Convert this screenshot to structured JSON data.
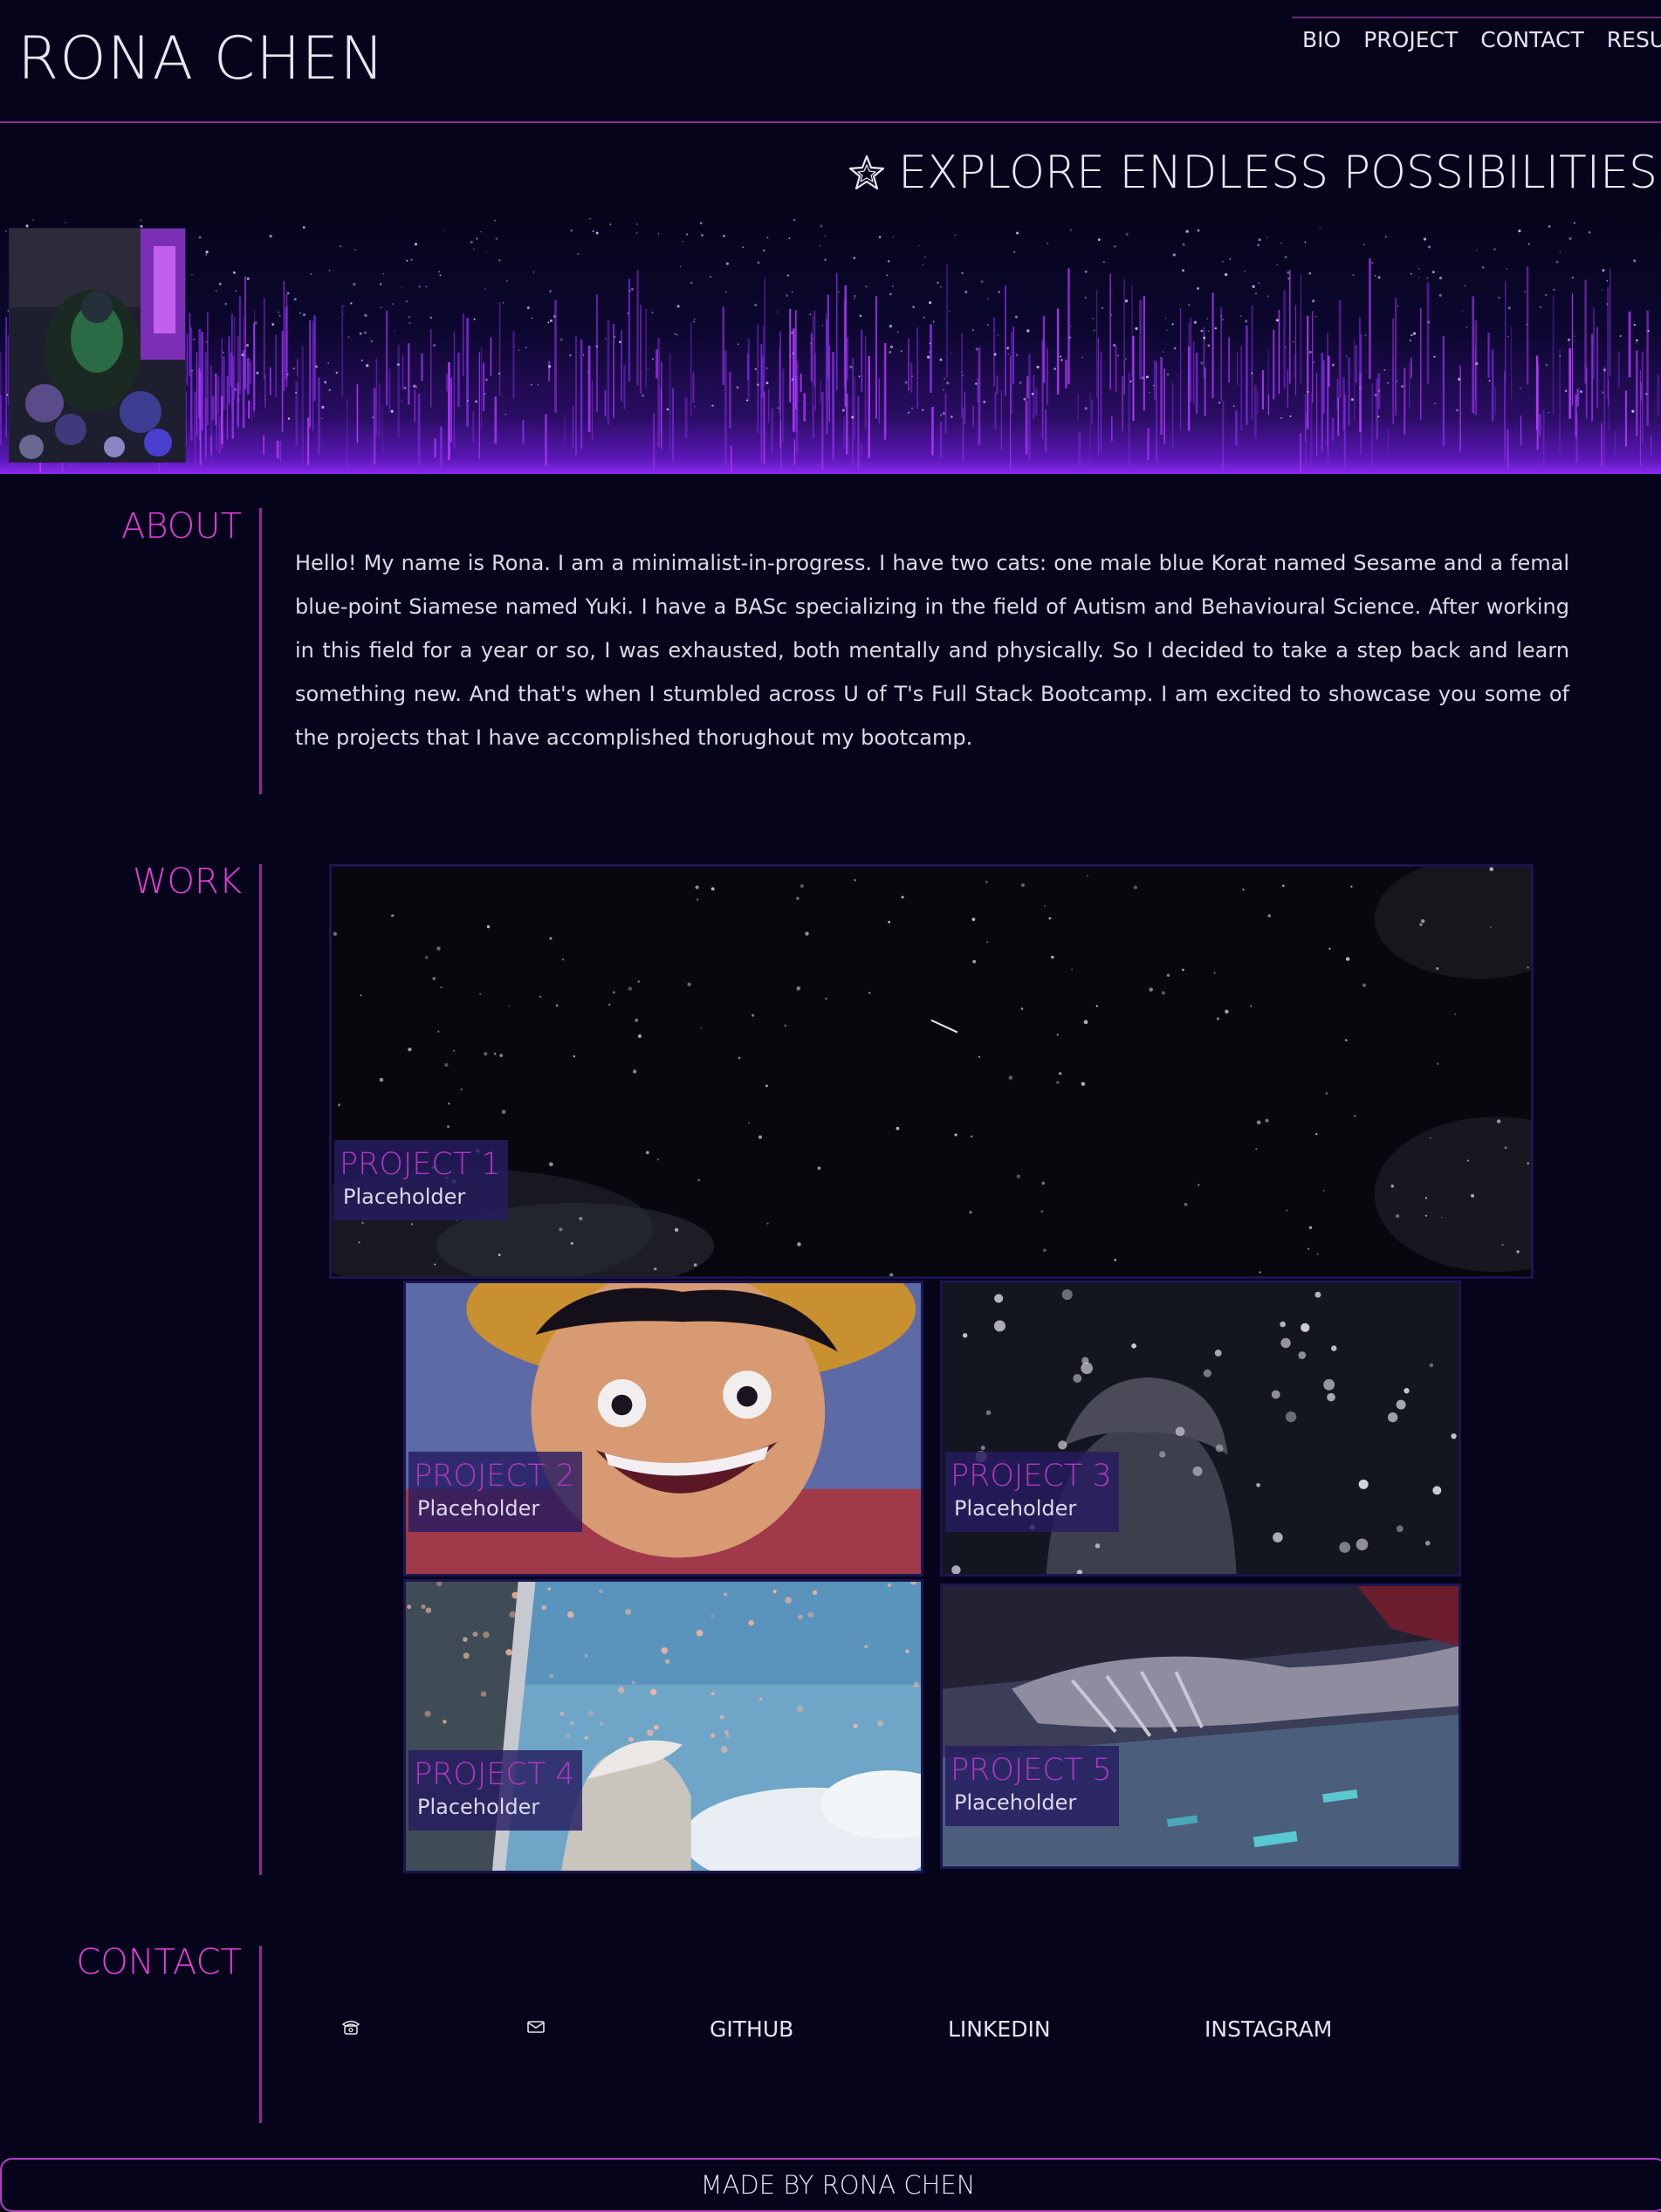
{
  "header": {
    "title": "RONA CHEN",
    "nav": [
      "BIO",
      "PROJECT",
      "CONTACT",
      "RESUME"
    ]
  },
  "hero": {
    "tagline": "EXPLORE ENDLESS POSSIBILITIES",
    "tagline_icon": "star-icon"
  },
  "about": {
    "label": "ABOUT",
    "text": "Hello! My name is Rona. I am a minimalist-in-progress. I have two cats: one male blue Korat named Sesame and a femal blue-point Siamese named Yuki. I have a BASc specializing in the field of Autism and Behavioural Science. After working in this field for a year or so, I was exhausted, both mentally and physically. So I decided to take a step back and learn something new. And that's when I stumbled across U of T's Full Stack Bootcamp. I am excited to showcase you some of the projects that I have accomplished thorughout my bootcamp."
  },
  "work": {
    "label": "WORK",
    "projects": [
      {
        "title": "PROJECT 1",
        "desc": "Placeholder"
      },
      {
        "title": "PROJECT 2",
        "desc": "Placeholder"
      },
      {
        "title": "PROJECT 3",
        "desc": "Placeholder"
      },
      {
        "title": "PROJECT 4",
        "desc": "Placeholder"
      },
      {
        "title": "PROJECT 5",
        "desc": "Placeholder"
      }
    ]
  },
  "contact": {
    "label": "CONTACT",
    "phone_icon": "phone-icon",
    "email_icon": "mail-icon",
    "links": [
      "GITHUB",
      "LINKEDIN",
      "INSTAGRAM"
    ]
  },
  "footer": {
    "text": "MADE BY RONA CHEN"
  },
  "colors": {
    "background": "#05041b",
    "accent": "#e43ed6",
    "rule": "#8e2c99",
    "project_title": "#b138c3"
  }
}
